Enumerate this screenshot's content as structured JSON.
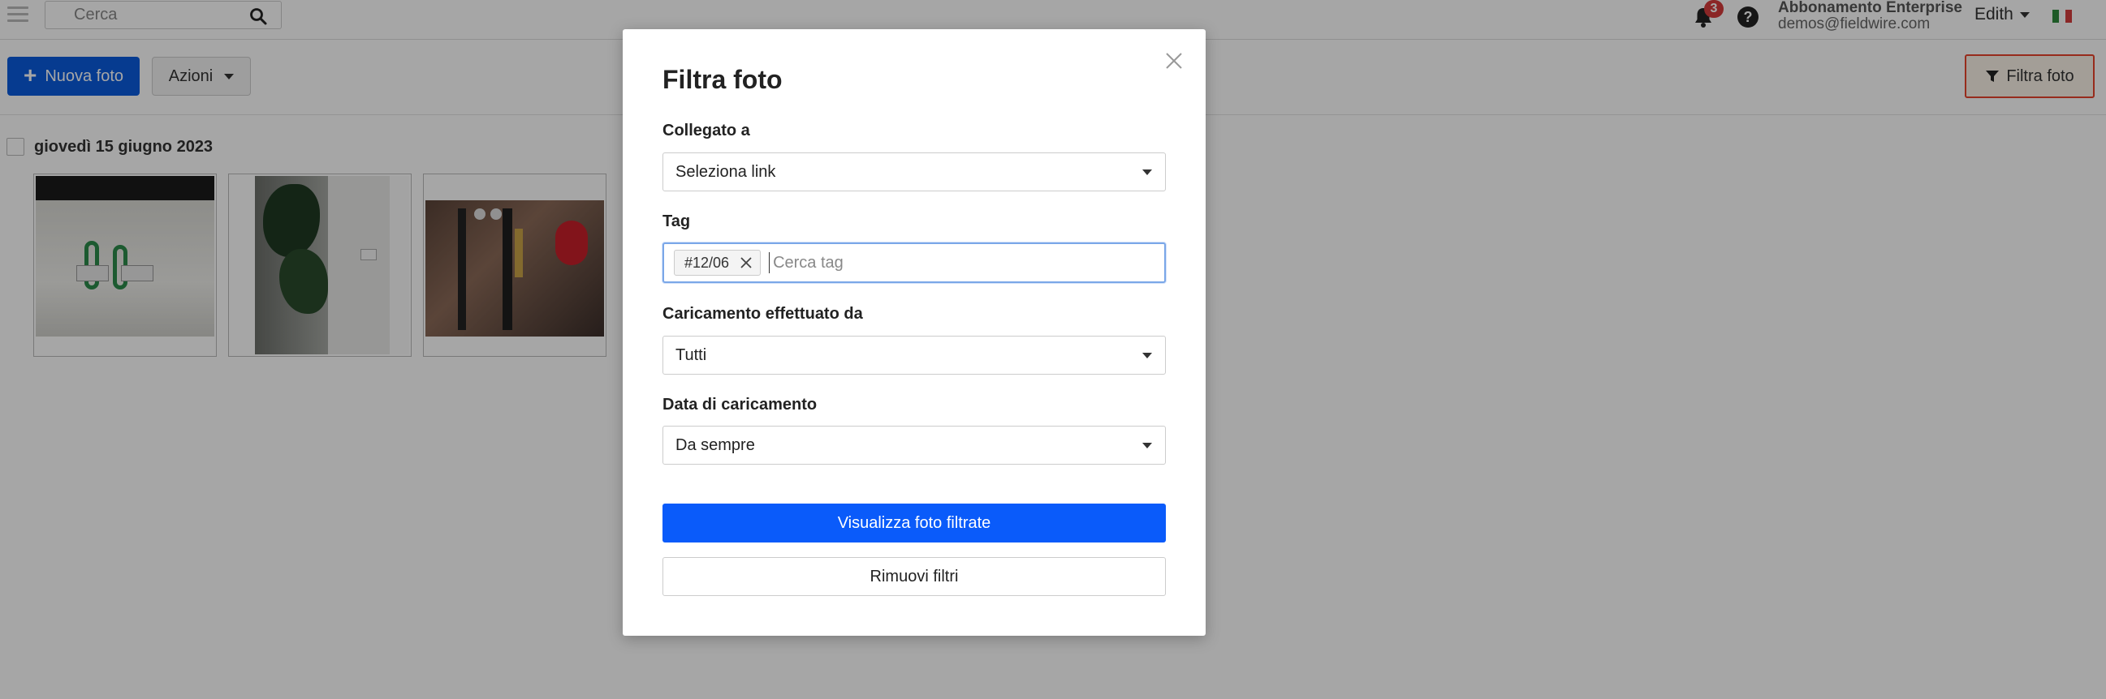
{
  "topbar": {
    "search_placeholder": "Cerca",
    "notification_count": "3",
    "help_label": "?",
    "plan": "Abbonamento Enterprise",
    "email": "demos@fieldwire.com",
    "user_name": "Edith",
    "flag_colors": [
      "#2e8b3d",
      "#ffffff",
      "#d43d3d"
    ]
  },
  "toolbar": {
    "new_photo_label": "Nuova foto",
    "actions_label": "Azioni",
    "filter_label": "Filtra foto"
  },
  "content": {
    "date_label": "giovedì 15 giugno 2023"
  },
  "modal": {
    "title": "Filtra foto",
    "linked_label": "Collegato a",
    "linked_value": "Seleziona link",
    "tag_label": "Tag",
    "tag_chip": "#12/06",
    "tag_placeholder": "Cerca tag",
    "uploaded_by_label": "Caricamento effettuato da",
    "uploaded_by_value": "Tutti",
    "upload_date_label": "Data di caricamento",
    "upload_date_value": "Da sempre",
    "apply_label": "Visualizza foto filtrate",
    "clear_label": "Rimuovi filtri"
  },
  "colors": {
    "primary": "#0a5bfa",
    "badge": "#d63b3b",
    "filter_highlight_border": "#e8432b"
  }
}
